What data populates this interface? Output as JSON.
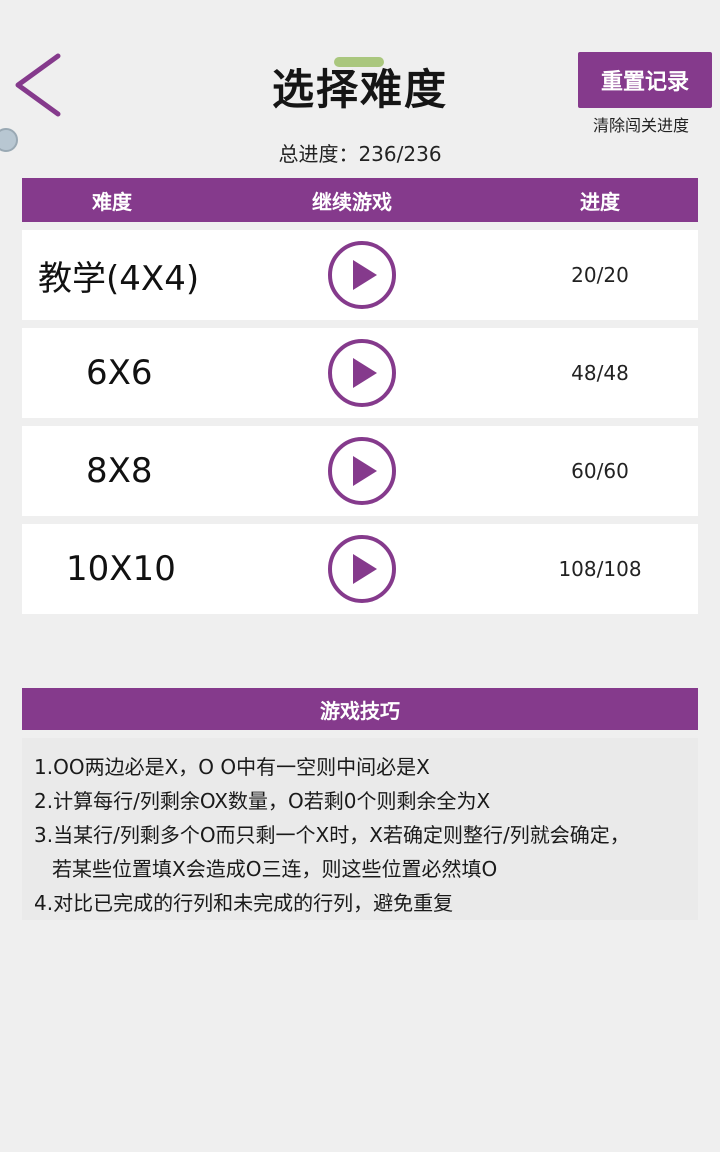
{
  "header": {
    "title": "选择难度",
    "reset_label": "重置记录",
    "reset_hint": "清除闯关进度",
    "total_progress": "总进度：236/236"
  },
  "table": {
    "columns": [
      "难度",
      "继续游戏",
      "进度"
    ],
    "rows": [
      {
        "difficulty": "教学(4X4)",
        "progress": "20/20"
      },
      {
        "difficulty": "6X6",
        "progress": "48/48"
      },
      {
        "difficulty": "8X8",
        "progress": "60/60"
      },
      {
        "difficulty": "10X10",
        "progress": "108/108"
      }
    ]
  },
  "tips": {
    "title": "游戏技巧",
    "lines": [
      "1.OO两边必是X，O O中有一空则中间必是X",
      "2.计算每行/列剩余OX数量，O若剩0个则剩余全为X",
      "3.当某行/列剩多个O而只剩一个X时，X若确定则整行/列就会确定，",
      "若某些位置填X会造成O三连，则这些位置必然填O",
      "4.对比已完成的行列和未完成的行列，避免重复"
    ]
  },
  "icons": {
    "back": "chevron-left-icon",
    "play": "play-icon"
  },
  "colors": {
    "accent": "#853a8c",
    "background": "#efefef"
  }
}
